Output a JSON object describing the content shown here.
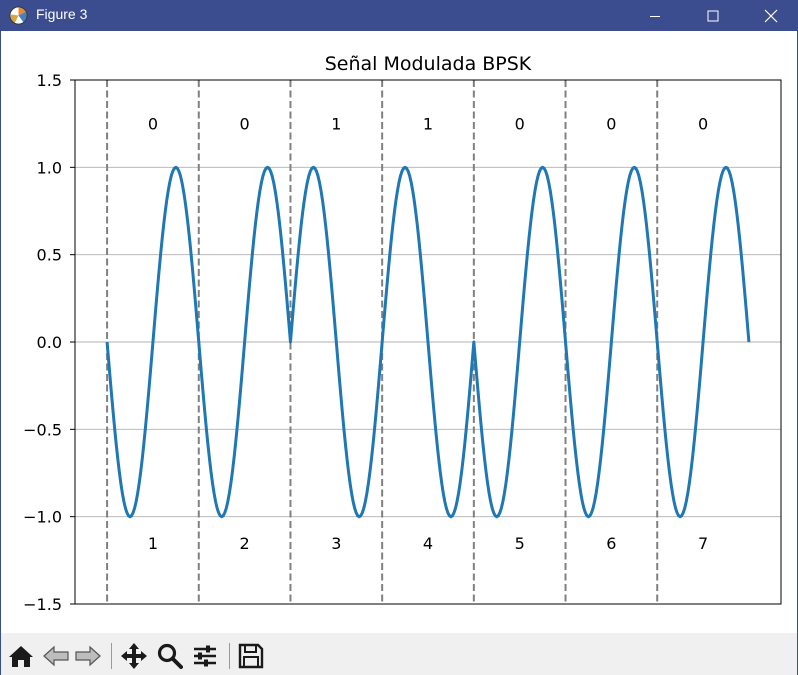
{
  "window": {
    "title": "Figure 3",
    "controls": [
      "minimize",
      "maximize",
      "close"
    ]
  },
  "toolbar": {
    "buttons": [
      "home-icon",
      "back-icon",
      "forward-icon",
      "pan-icon",
      "zoom-icon",
      "configure-subplots-icon",
      "save-icon"
    ]
  },
  "chart_data": {
    "type": "line",
    "title": "Señal Modulada BPSK",
    "xlabel": "",
    "ylabel": "",
    "xlim": [
      -0.35,
      7.35
    ],
    "ylim": [
      -1.5,
      1.5
    ],
    "yticks": [
      -1.5,
      -1.0,
      -0.5,
      0.0,
      0.5,
      1.0,
      1.5
    ],
    "ytick_labels": [
      "−1.5",
      "−1.0",
      "−0.5",
      "0.0",
      "0.5",
      "1.0",
      "1.5"
    ],
    "grid": "horizontal",
    "bits": [
      "0",
      "0",
      "1",
      "1",
      "0",
      "0",
      "0"
    ],
    "bit_labels_y": 1.25,
    "symbol_numbers": [
      "1",
      "2",
      "3",
      "4",
      "5",
      "6",
      "7"
    ],
    "symbol_labels_y": -1.15,
    "boundaries": [
      0,
      1,
      2,
      3,
      4,
      5,
      6
    ],
    "series": [
      {
        "color": "#1f77b4",
        "function": "sin(2*pi*t) with phase pi for bit 0, 0 for bit 1",
        "x_range": [
          0,
          7
        ],
        "points_per_symbol": 60
      }
    ],
    "colors": {
      "line": "#1f77b4",
      "boundary": "#808080",
      "grid": "#b0b0b0"
    }
  }
}
